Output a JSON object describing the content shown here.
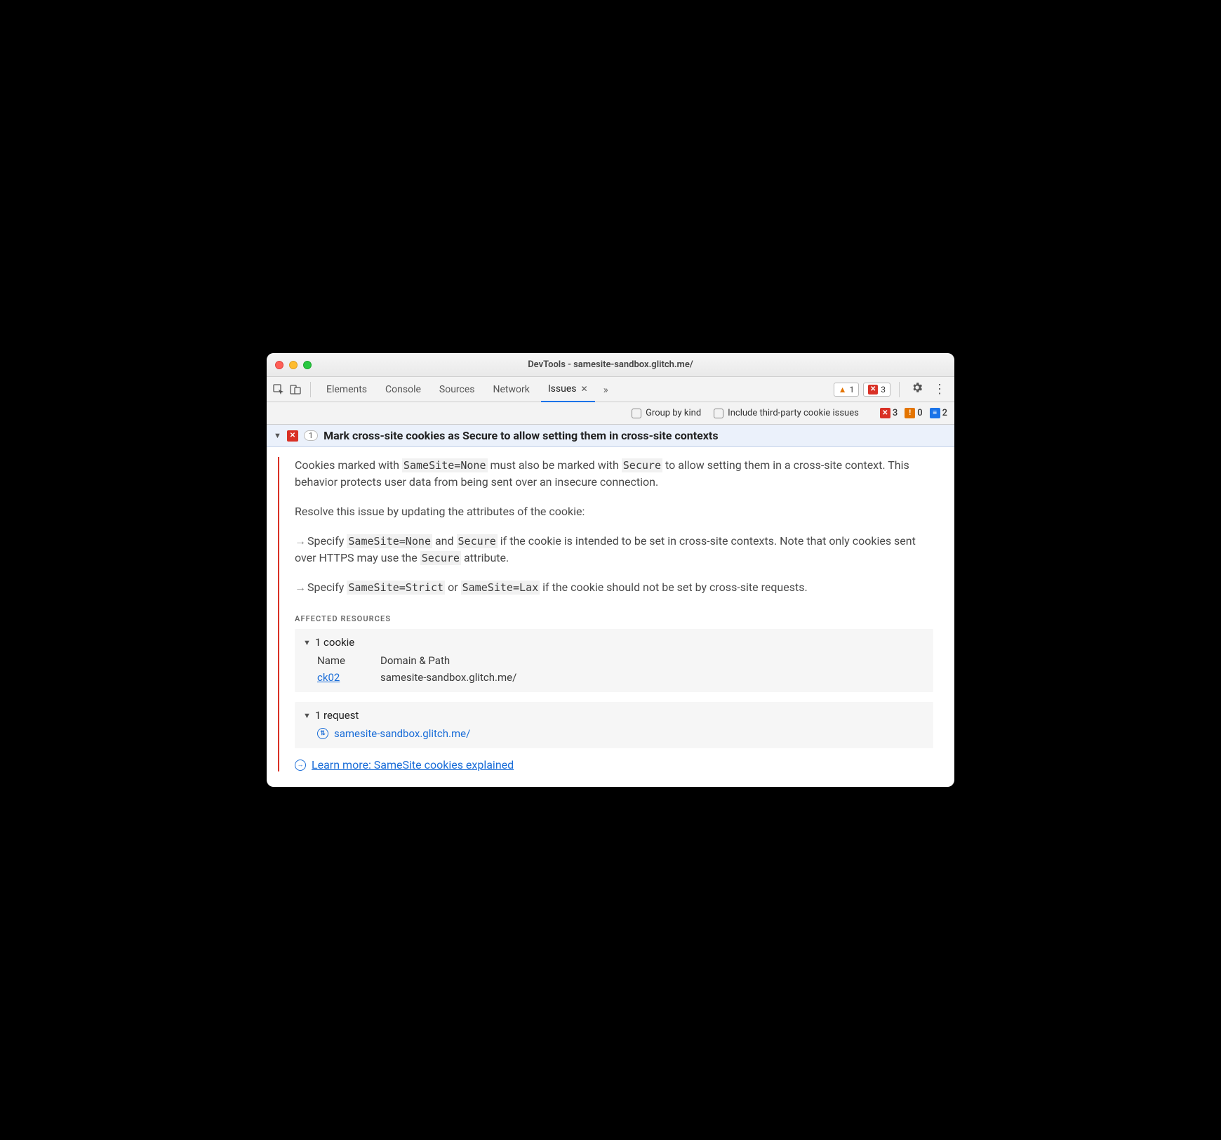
{
  "window": {
    "title": "DevTools - samesite-sandbox.glitch.me/"
  },
  "tabs": {
    "items": [
      "Elements",
      "Console",
      "Sources",
      "Network",
      "Issues"
    ],
    "active": "Issues"
  },
  "topbar_badges": {
    "warn": "1",
    "err": "3"
  },
  "filterbar": {
    "group_by_kind": "Group by kind",
    "include_third_party": "Include third-party cookie issues",
    "counts": {
      "error": "3",
      "warn": "0",
      "info": "2"
    }
  },
  "issue": {
    "count": "1",
    "title": "Mark cross-site cookies as Secure to allow setting them in cross-site contexts",
    "p1_a": "Cookies marked with ",
    "p1_code1": "SameSite=None",
    "p1_b": " must also be marked with ",
    "p1_code2": "Secure",
    "p1_c": " to allow setting them in a cross-site context. This behavior protects user data from being sent over an insecure connection.",
    "p2": "Resolve this issue by updating the attributes of the cookie:",
    "b1_a": "Specify ",
    "b1_code1": "SameSite=None",
    "b1_b": " and ",
    "b1_code2": "Secure",
    "b1_c": " if the cookie is intended to be set in cross-site contexts. Note that only cookies sent over HTTPS may use the ",
    "b1_code3": "Secure",
    "b1_d": " attribute.",
    "b2_a": "Specify ",
    "b2_code1": "SameSite=Strict",
    "b2_b": " or ",
    "b2_code2": "SameSite=Lax",
    "b2_c": " if the cookie should not be set by cross-site requests."
  },
  "affected": {
    "heading": "AFFECTED RESOURCES",
    "cookies": {
      "header": "1 cookie",
      "col_name": "Name",
      "col_domain": "Domain & Path",
      "row": {
        "name": "ck02",
        "domain": "samesite-sandbox.glitch.me/"
      }
    },
    "requests": {
      "header": "1 request",
      "url": "samesite-sandbox.glitch.me/"
    }
  },
  "learn_more": "Learn more: SameSite cookies explained"
}
